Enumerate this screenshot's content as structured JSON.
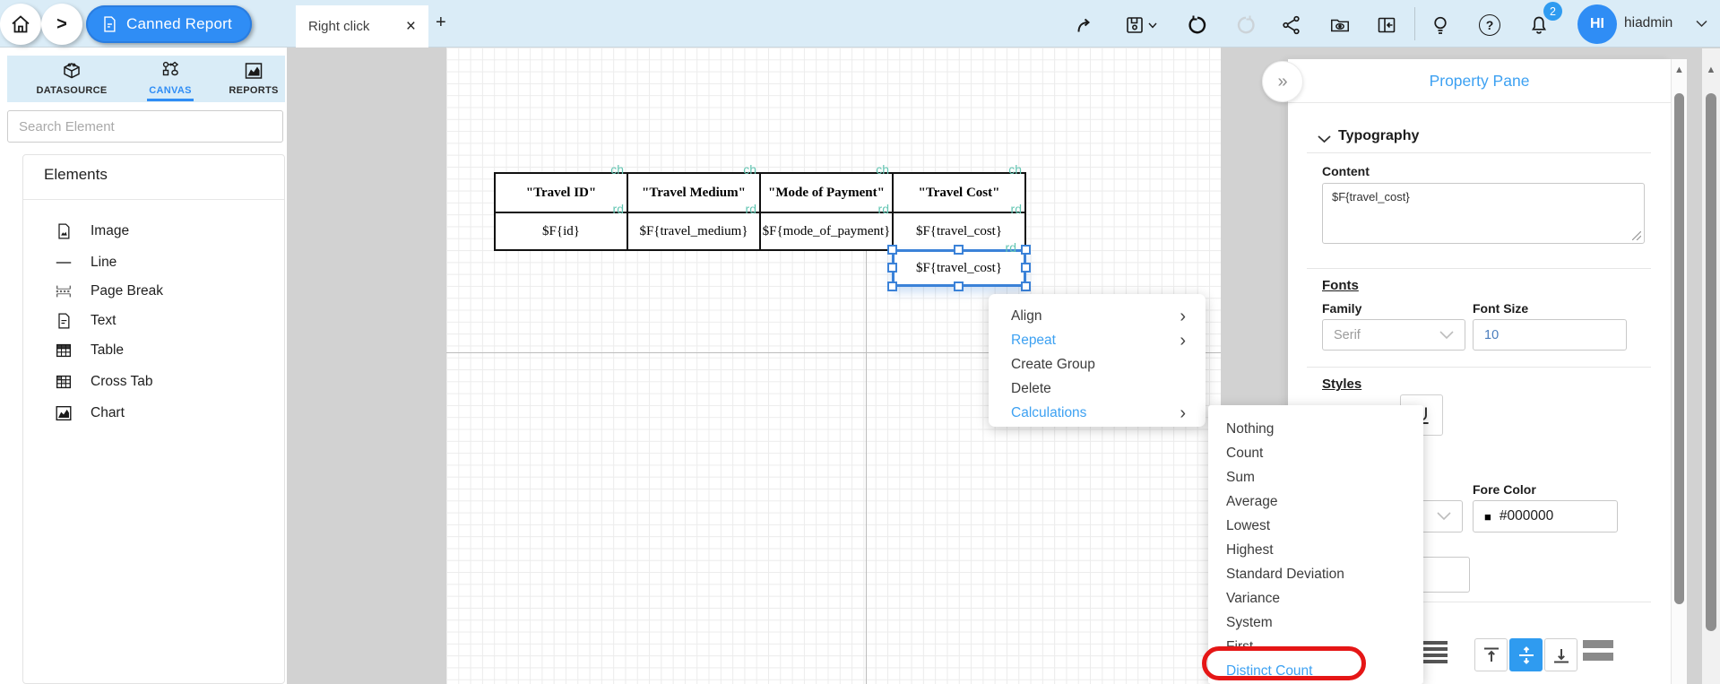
{
  "app": {
    "title": "Canned Report"
  },
  "topbar": {
    "breadcrumb_chevron": ">",
    "tab": {
      "label": "Right click",
      "close_glyph": "×"
    },
    "new_tab_glyph": "+",
    "notifications_badge": "2",
    "user": {
      "initials": "HI",
      "name": "hiadmin"
    },
    "help_glyph": "?"
  },
  "sidebar": {
    "tabs": [
      {
        "label": "DATASOURCE"
      },
      {
        "label": "CANVAS"
      },
      {
        "label": "REPORTS"
      }
    ],
    "active_tab": "CANVAS",
    "search_placeholder": "Search Element",
    "panel_title": "Elements",
    "elements": [
      {
        "label": "Image"
      },
      {
        "label": "Line"
      },
      {
        "label": "Page Break"
      },
      {
        "label": "Text"
      },
      {
        "label": "Table"
      },
      {
        "label": "Cross Tab"
      },
      {
        "label": "Chart"
      }
    ]
  },
  "canvas": {
    "table": {
      "header_tag": "ch",
      "row_tag": "rd",
      "columns": [
        {
          "header": "\"Travel ID\"",
          "field": "$F{id}"
        },
        {
          "header": "\"Travel Medium\"",
          "field": "$F{travel_medium}"
        },
        {
          "header": "\"Mode of Payment\"",
          "field": "$F{mode_of_payment}"
        },
        {
          "header": "\"Travel Cost\"",
          "field": "$F{travel_cost}"
        }
      ]
    },
    "selected_cell": {
      "text": "$F{travel_cost}",
      "tag": "rd"
    }
  },
  "context_menu": {
    "arrow_glyph": "›",
    "items": [
      {
        "label": "Align"
      },
      {
        "label": "Repeat"
      },
      {
        "label": "Create Group"
      },
      {
        "label": "Delete"
      },
      {
        "label": "Calculations"
      }
    ]
  },
  "submenu": {
    "items": [
      "Nothing",
      "Count",
      "Sum",
      "Average",
      "Lowest",
      "Highest",
      "Standard Deviation",
      "Variance",
      "System",
      "First",
      "Distinct Count"
    ],
    "highlighted_item": "Distinct Count"
  },
  "property_pane": {
    "title": "Property Pane",
    "collapse_glyph": "»",
    "typography": {
      "section_label": "Typography",
      "content_label": "Content",
      "content_value": "$F{travel_cost}",
      "fonts_label": "Fonts",
      "family_label": "Family",
      "family_value": "Serif",
      "font_size_label": "Font Size",
      "font_size_value": "10",
      "styles_label": "Styles",
      "underline_glyph": "U",
      "fore_color_label": "Fore Color",
      "fore_color_swatch": "■",
      "fore_color_value": "#000000"
    }
  },
  "scrollbar": {
    "up_glyph": "▲"
  },
  "colors": {
    "accent_blue": "#2f8df5",
    "menu_blue": "#3da1f2",
    "band_tag_teal": "#63c6b3",
    "annotation_red": "#e51616",
    "fore_color": "#000000",
    "selection_blue": "#3b82d8"
  }
}
